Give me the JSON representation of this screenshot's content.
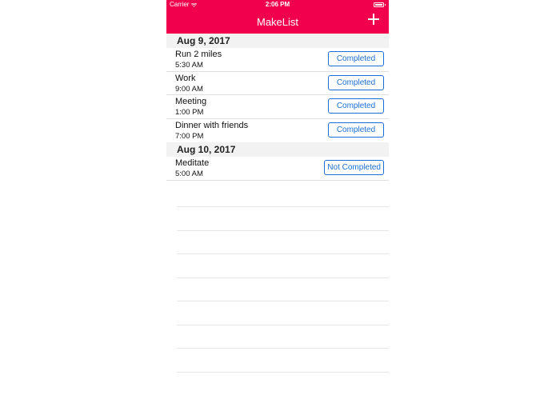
{
  "status_bar": {
    "carrier": "Carrier",
    "time": "2:06 PM"
  },
  "nav": {
    "title": "MakeList",
    "add_icon": "plus-icon"
  },
  "colors": {
    "accent": "#f0004d",
    "button_blue": "#1a6fd6"
  },
  "sections": [
    {
      "date": "Aug 9, 2017",
      "items": [
        {
          "title": "Run 2 miles",
          "time": "5:30 AM",
          "status": "Completed"
        },
        {
          "title": "Work",
          "time": "9:00 AM",
          "status": "Completed"
        },
        {
          "title": "Meeting",
          "time": "1:00 PM",
          "status": "Completed"
        },
        {
          "title": "Dinner with friends",
          "time": "7:00 PM",
          "status": "Completed"
        }
      ]
    },
    {
      "date": "Aug 10, 2017",
      "items": [
        {
          "title": "Meditate",
          "time": "5:00 AM",
          "status": "Not Completed"
        }
      ]
    }
  ]
}
